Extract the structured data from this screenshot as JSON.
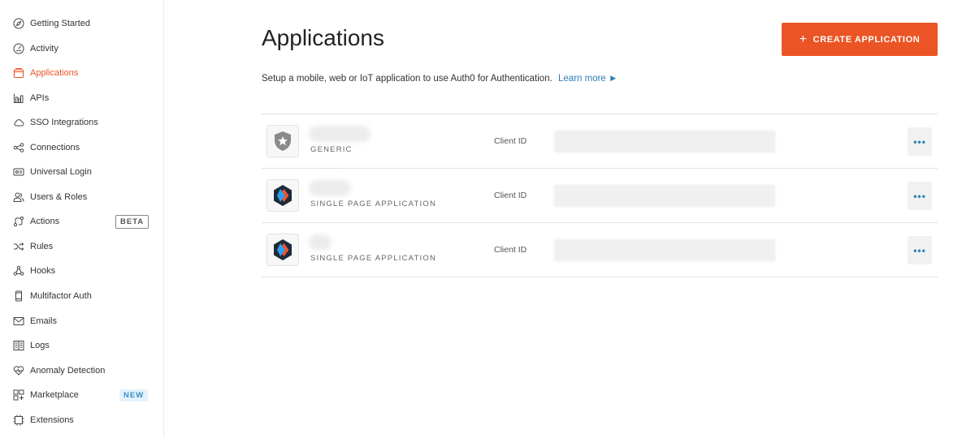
{
  "sidebar": {
    "items": [
      {
        "label": "Getting Started",
        "icon": "compass-icon"
      },
      {
        "label": "Activity",
        "icon": "activity-gauge-icon"
      },
      {
        "label": "Applications",
        "icon": "applications-icon",
        "active": true
      },
      {
        "label": "APIs",
        "icon": "apis-icon"
      },
      {
        "label": "SSO Integrations",
        "icon": "cloud-icon"
      },
      {
        "label": "Connections",
        "icon": "connections-icon"
      },
      {
        "label": "Universal Login",
        "icon": "universal-login-icon"
      },
      {
        "label": "Users & Roles",
        "icon": "users-icon"
      },
      {
        "label": "Actions",
        "icon": "actions-icon",
        "badge": "BETA"
      },
      {
        "label": "Rules",
        "icon": "rules-shuffle-icon"
      },
      {
        "label": "Hooks",
        "icon": "hooks-icon"
      },
      {
        "label": "Multifactor Auth",
        "icon": "phone-icon"
      },
      {
        "label": "Emails",
        "icon": "mail-icon"
      },
      {
        "label": "Logs",
        "icon": "book-icon"
      },
      {
        "label": "Anomaly Detection",
        "icon": "heart-icon"
      },
      {
        "label": "Marketplace",
        "icon": "marketplace-icon",
        "badge": "NEW"
      },
      {
        "label": "Extensions",
        "icon": "chip-icon"
      }
    ]
  },
  "header": {
    "title": "Applications",
    "create_button": "CREATE APPLICATION",
    "create_icon": "+",
    "subtitle": "Setup a mobile, web or IoT application to use Auth0 for Authentication.",
    "learn_more": "Learn more ►"
  },
  "applications": [
    {
      "type": "GENERIC",
      "client_label": "Client ID",
      "logo": "auth0-shield-icon"
    },
    {
      "type": "SINGLE PAGE APPLICATION",
      "client_label": "Client ID",
      "logo": "spa-hexagon-icon"
    },
    {
      "type": "SINGLE PAGE APPLICATION",
      "client_label": "Client ID",
      "logo": "spa-hexagon-icon"
    }
  ],
  "more_label": "•••",
  "colors": {
    "accent": "#eb5424",
    "link": "#2d7fb5"
  }
}
